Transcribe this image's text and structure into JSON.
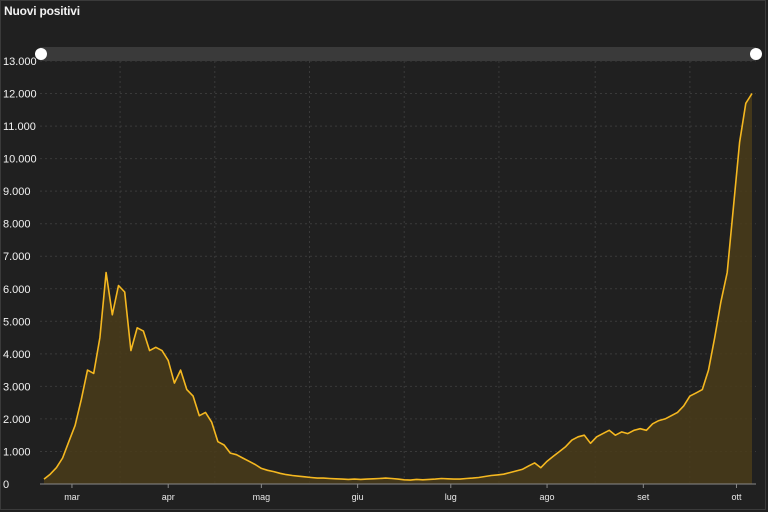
{
  "chart_data": {
    "type": "area",
    "title": "Nuovi positivi",
    "xlabel": "",
    "ylabel": "",
    "ylim": [
      0,
      13000
    ],
    "y_ticks": [
      "0",
      "1.000",
      "2.000",
      "3.000",
      "4.000",
      "5.000",
      "6.000",
      "7.000",
      "8.000",
      "9.000",
      "10.000",
      "11.000",
      "12.000",
      "13.000"
    ],
    "x_ticks": [
      {
        "label": "mar",
        "day": 9
      },
      {
        "label": "apr",
        "day": 40
      },
      {
        "label": "mag",
        "day": 70
      },
      {
        "label": "giu",
        "day": 101
      },
      {
        "label": "lug",
        "day": 131
      },
      {
        "label": "ago",
        "day": 162
      },
      {
        "label": "set",
        "day": 193
      },
      {
        "label": "ott",
        "day": 223
      }
    ],
    "grid": true,
    "legend": "none",
    "colors": {
      "line": "#f5b820",
      "fill": "#4a3c1a",
      "grid": "#3a3a3a",
      "background": "#202020",
      "navigator": "#3a3a3a"
    },
    "x": [
      0,
      2,
      4,
      6,
      8,
      10,
      12,
      14,
      16,
      18,
      20,
      22,
      24,
      26,
      28,
      30,
      32,
      34,
      36,
      38,
      40,
      42,
      44,
      46,
      48,
      50,
      52,
      54,
      56,
      58,
      60,
      62,
      64,
      66,
      68,
      70,
      72,
      74,
      76,
      78,
      80,
      82,
      84,
      86,
      88,
      90,
      92,
      94,
      96,
      98,
      100,
      102,
      104,
      106,
      108,
      110,
      112,
      114,
      116,
      118,
      120,
      122,
      124,
      126,
      128,
      130,
      132,
      134,
      136,
      138,
      140,
      142,
      144,
      146,
      148,
      150,
      152,
      154,
      156,
      158,
      160,
      162,
      164,
      166,
      168,
      170,
      172,
      174,
      176,
      178,
      180,
      182,
      184,
      186,
      188,
      190,
      192,
      194,
      196,
      198,
      200,
      202,
      204,
      206,
      208,
      210,
      212,
      214,
      216,
      218,
      220,
      222,
      224,
      226,
      228
    ],
    "series": [
      {
        "values": [
          150,
          300,
          500,
          800,
          1300,
          1800,
          2600,
          3500,
          3400,
          4500,
          6500,
          5200,
          6100,
          5900,
          4100,
          4800,
          4700,
          4100,
          4200,
          4100,
          3800,
          3100,
          3500,
          2900,
          2700,
          2100,
          2200,
          1900,
          1300,
          1200,
          950,
          900,
          800,
          700,
          600,
          480,
          420,
          380,
          330,
          290,
          260,
          240,
          220,
          200,
          180,
          180,
          170,
          160,
          150,
          140,
          150,
          140,
          150,
          160,
          170,
          180,
          170,
          150,
          130,
          120,
          140,
          130,
          140,
          150,
          170,
          160,
          150,
          150,
          170,
          180,
          200,
          230,
          260,
          280,
          300,
          350,
          400,
          450,
          550,
          650,
          500,
          700,
          850,
          1000,
          1150,
          1350,
          1450,
          1500,
          1250,
          1450,
          1550,
          1650,
          1500,
          1600,
          1550,
          1650,
          1700,
          1650,
          1850,
          1950,
          2000,
          2100,
          2200,
          2400,
          2700,
          2800,
          2900,
          3500,
          4500,
          5600,
          6500,
          8500,
          10500,
          11700,
          12000
        ]
      }
    ]
  }
}
